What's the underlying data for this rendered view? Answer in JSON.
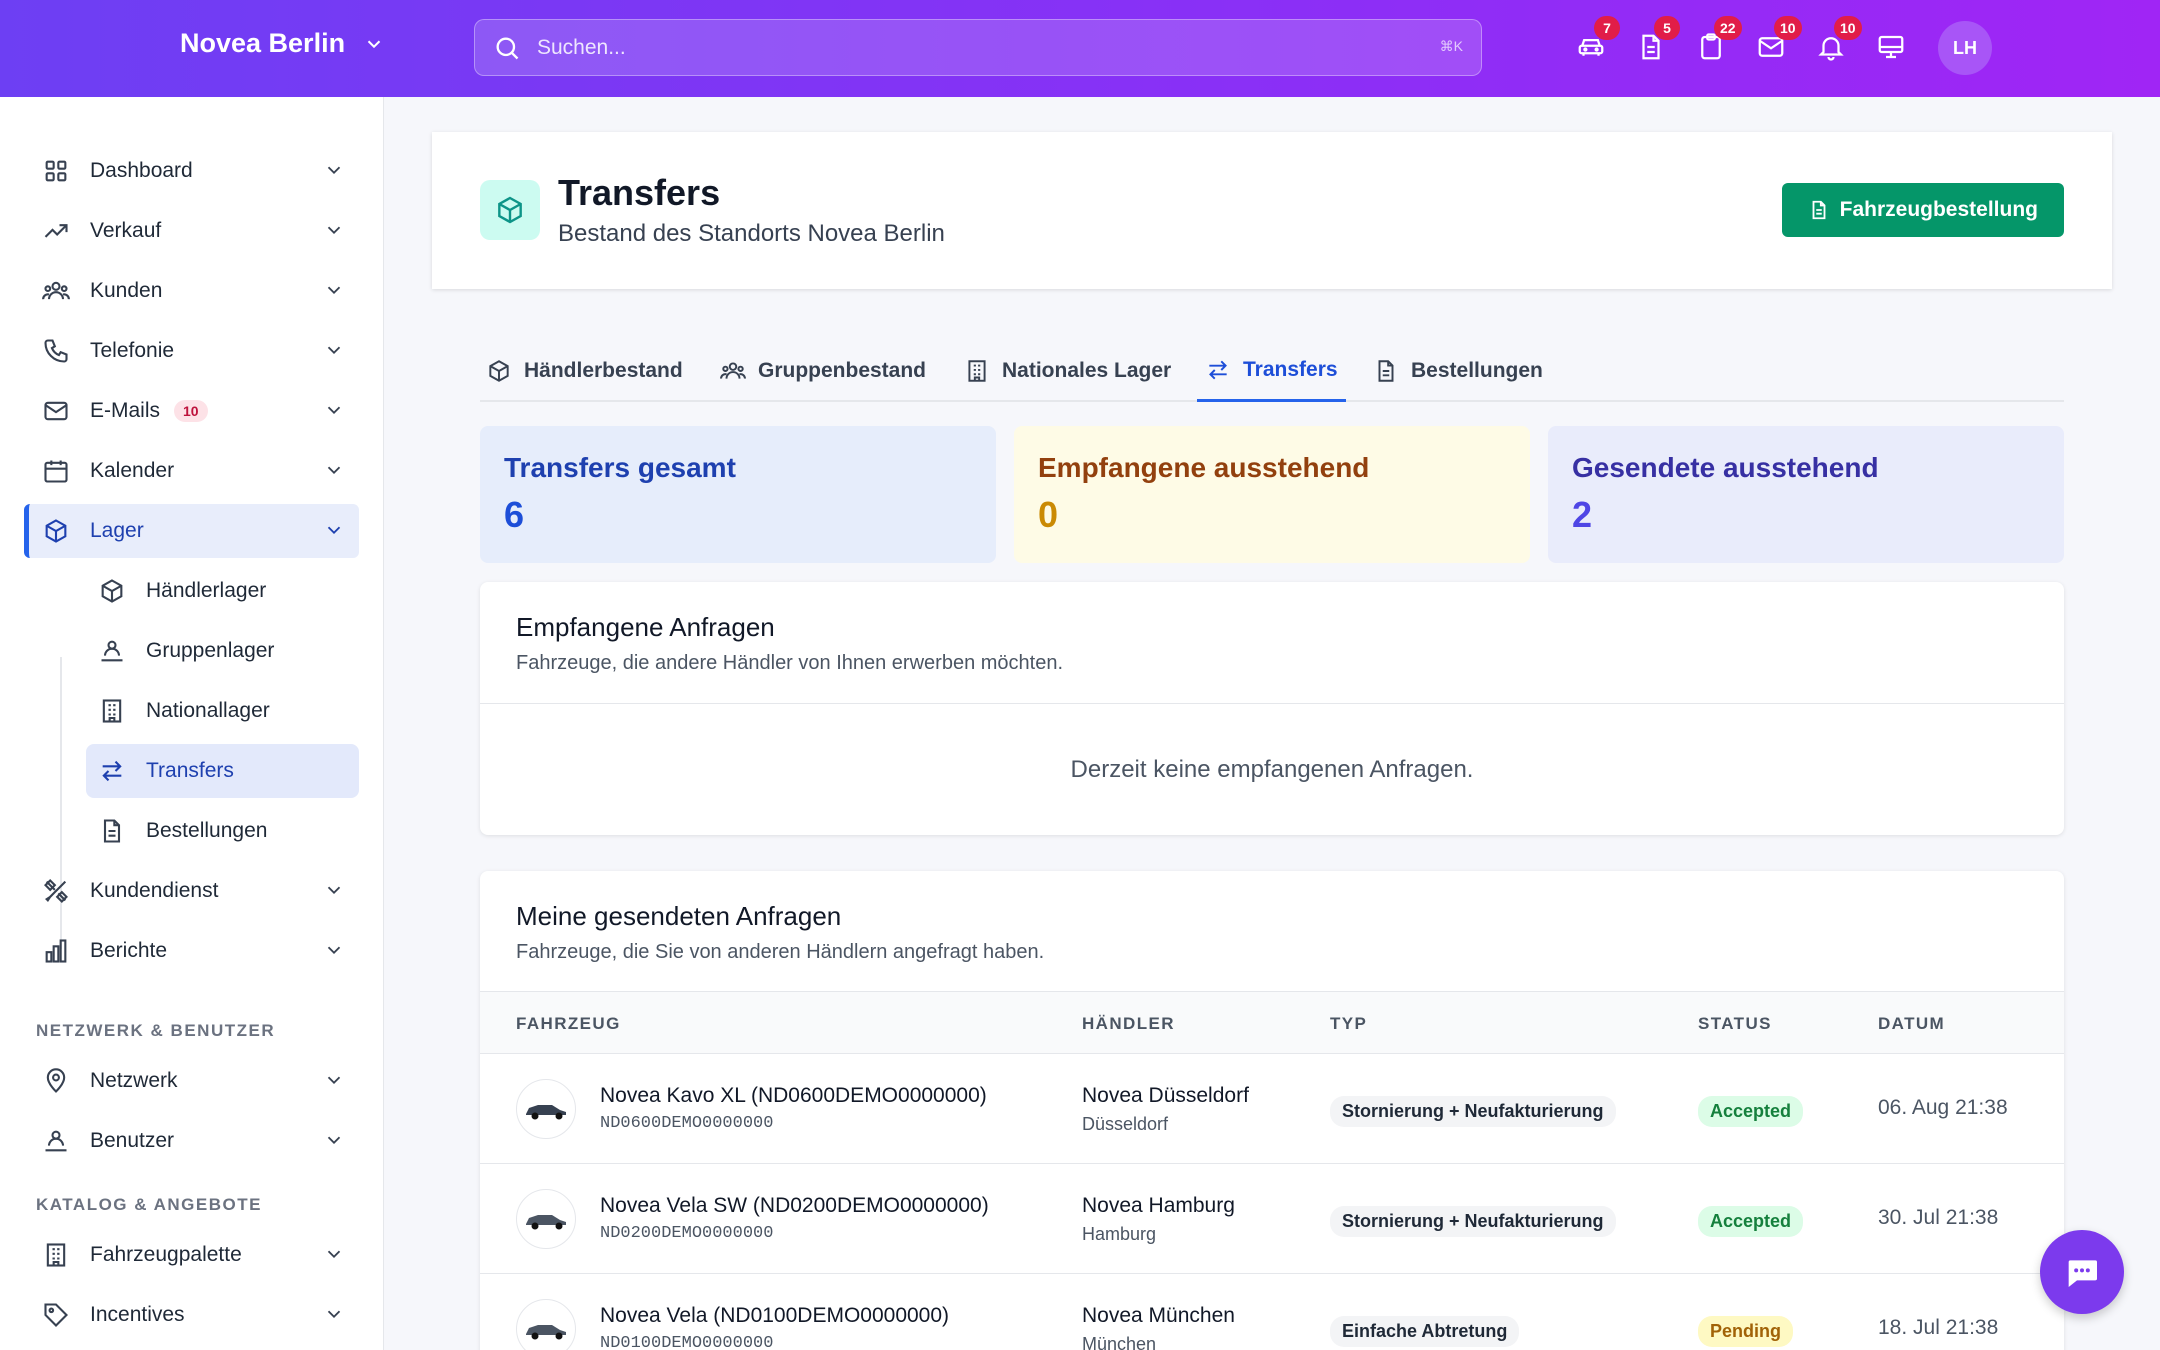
{
  "topbar": {
    "location": "Novea Berlin",
    "search_placeholder": "Suchen...",
    "search_shortcut": "⌘K",
    "badges": {
      "vehicles": "7",
      "documents": "5",
      "clipboard": "22",
      "mail": "10",
      "notifications": "10"
    },
    "avatar_initials": "LH"
  },
  "sidebar": {
    "items": [
      {
        "label": "Dashboard",
        "icon": "grid-icon"
      },
      {
        "label": "Verkauf",
        "icon": "trending-up-icon"
      },
      {
        "label": "Kunden",
        "icon": "users-icon"
      },
      {
        "label": "Telefonie",
        "icon": "phone-icon"
      },
      {
        "label": "E-Mails",
        "icon": "mail-icon",
        "badge": "10"
      },
      {
        "label": "Kalender",
        "icon": "calendar-icon"
      },
      {
        "label": "Lager",
        "icon": "box-icon"
      }
    ],
    "lager_sub": [
      {
        "label": "Händlerlager",
        "icon": "box-icon"
      },
      {
        "label": "Gruppenlager",
        "icon": "user-group-icon"
      },
      {
        "label": "Nationallager",
        "icon": "building-icon"
      },
      {
        "label": "Transfers",
        "icon": "arrows-icon"
      },
      {
        "label": "Bestellungen",
        "icon": "document-icon"
      }
    ],
    "items2": [
      {
        "label": "Kundendienst",
        "icon": "tools-icon"
      },
      {
        "label": "Berichte",
        "icon": "chart-icon"
      }
    ],
    "section_network": "NETZWERK & BENUTZER",
    "network_items": [
      {
        "label": "Netzwerk",
        "icon": "location-icon"
      },
      {
        "label": "Benutzer",
        "icon": "user-group-icon"
      }
    ],
    "section_catalog": "KATALOG & ANGEBOTE",
    "catalog_items": [
      {
        "label": "Fahrzeugpalette",
        "icon": "building-icon"
      },
      {
        "label": "Incentives",
        "icon": "tag-icon"
      }
    ]
  },
  "header": {
    "title": "Transfers",
    "subtitle": "Bestand des Standorts Novea Berlin",
    "button": "Fahrzeugbestellung"
  },
  "tabs": [
    "Händlerbestand",
    "Gruppenbestand",
    "Nationales Lager",
    "Transfers",
    "Bestellungen"
  ],
  "stats": [
    {
      "label": "Transfers gesamt",
      "value": "6"
    },
    {
      "label": "Empfangene ausstehend",
      "value": "0"
    },
    {
      "label": "Gesendete ausstehend",
      "value": "2"
    }
  ],
  "received": {
    "title": "Empfangene Anfragen",
    "subtitle": "Fahrzeuge, die andere Händler von Ihnen erwerben möchten.",
    "empty": "Derzeit keine empfangenen Anfragen."
  },
  "sent": {
    "title": "Meine gesendeten Anfragen",
    "subtitle": "Fahrzeuge, die Sie von anderen Händlern angefragt haben.",
    "columns": [
      "FAHRZEUG",
      "HÄNDLER",
      "TYP",
      "STATUS",
      "DATUM"
    ],
    "rows": [
      {
        "vehicle": "Novea Kavo XL (ND0600DEMO0000000)",
        "vin": "ND0600DEMO0000000",
        "dealer": "Novea Düsseldorf",
        "city": "Düsseldorf",
        "type": "Stornierung + Neufakturierung",
        "status": "Accepted",
        "date": "06. Aug 21:38"
      },
      {
        "vehicle": "Novea Vela SW (ND0200DEMO0000000)",
        "vin": "ND0200DEMO0000000",
        "dealer": "Novea Hamburg",
        "city": "Hamburg",
        "type": "Stornierung + Neufakturierung",
        "status": "Accepted",
        "date": "30. Jul 21:38"
      },
      {
        "vehicle": "Novea Vela (ND0100DEMO0000000)",
        "vin": "ND0100DEMO0000000",
        "dealer": "Novea München",
        "city": "München",
        "type": "Einfache Abtretung",
        "status": "Pending",
        "date": "18. Jul 21:38"
      }
    ]
  },
  "colors": {
    "accent": "#2563eb",
    "brand_gradient_start": "#6d3ff3",
    "brand_gradient_end": "#a025f5",
    "primary_button": "#059669"
  }
}
